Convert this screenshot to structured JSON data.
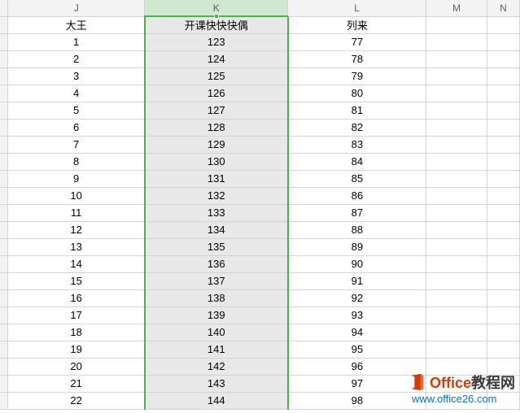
{
  "columns": {
    "j": "J",
    "k": "K",
    "l": "L",
    "m": "M",
    "n": "N"
  },
  "headers": {
    "j": "大王",
    "k": "开课快快快偶",
    "l": "列来"
  },
  "rows": [
    {
      "j": "1",
      "k": "123",
      "l": "77"
    },
    {
      "j": "2",
      "k": "124",
      "l": "78"
    },
    {
      "j": "3",
      "k": "125",
      "l": "79"
    },
    {
      "j": "4",
      "k": "126",
      "l": "80"
    },
    {
      "j": "5",
      "k": "127",
      "l": "81"
    },
    {
      "j": "6",
      "k": "128",
      "l": "82"
    },
    {
      "j": "7",
      "k": "129",
      "l": "83"
    },
    {
      "j": "8",
      "k": "130",
      "l": "84"
    },
    {
      "j": "9",
      "k": "131",
      "l": "85"
    },
    {
      "j": "10",
      "k": "132",
      "l": "86"
    },
    {
      "j": "11",
      "k": "133",
      "l": "87"
    },
    {
      "j": "12",
      "k": "134",
      "l": "88"
    },
    {
      "j": "13",
      "k": "135",
      "l": "89"
    },
    {
      "j": "14",
      "k": "136",
      "l": "90"
    },
    {
      "j": "15",
      "k": "137",
      "l": "91"
    },
    {
      "j": "16",
      "k": "138",
      "l": "92"
    },
    {
      "j": "17",
      "k": "139",
      "l": "93"
    },
    {
      "j": "18",
      "k": "140",
      "l": "94"
    },
    {
      "j": "19",
      "k": "141",
      "l": "95"
    },
    {
      "j": "20",
      "k": "142",
      "l": "96"
    },
    {
      "j": "21",
      "k": "143",
      "l": "97"
    },
    {
      "j": "22",
      "k": "144",
      "l": "98"
    }
  ],
  "watermark": {
    "title_part1": "Office",
    "title_part2": "教程网",
    "url": "www.office26.com"
  }
}
